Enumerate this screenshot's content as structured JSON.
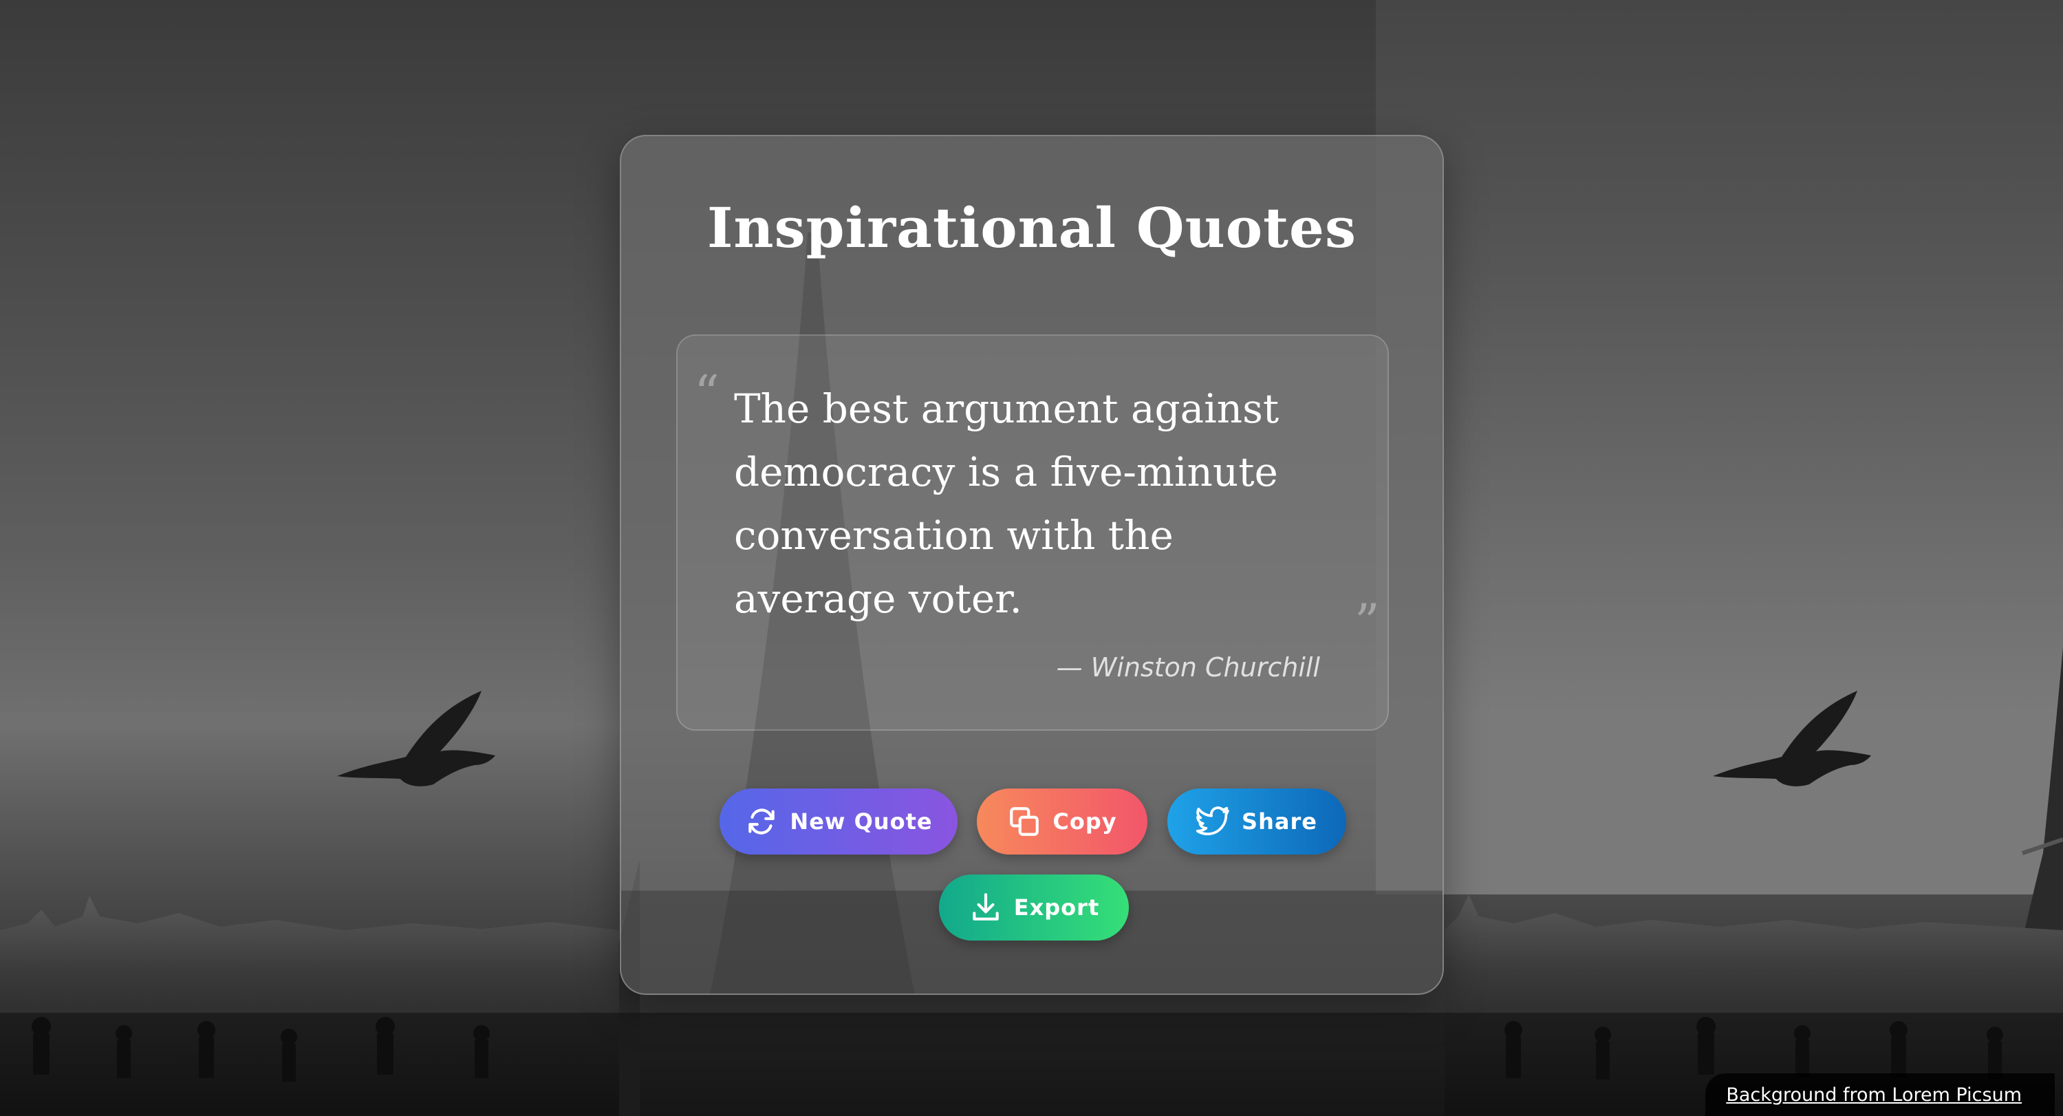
{
  "app": {
    "title": "Inspirational Quotes"
  },
  "quote": {
    "open_mark": "“",
    "close_mark": "”",
    "text": "The best argument against democracy is a five-minute conversation with the average voter.",
    "author": "— Winston Churchill"
  },
  "actions": {
    "new_quote_label": "New Quote",
    "copy_label": "Copy",
    "share_label": "Share",
    "export_label": "Export",
    "icons": {
      "new_quote": "refresh-icon",
      "copy": "copy-icon",
      "share": "twitter-icon",
      "export": "download-icon"
    }
  },
  "credit": {
    "text": "Background from Lorem Picsum"
  },
  "colors": {
    "new_quote_gradient": [
      "#5567e8",
      "#8a55e0"
    ],
    "copy_gradient": [
      "#f7895c",
      "#f2566a"
    ],
    "share_gradient": [
      "#1fa2e8",
      "#0d68b8"
    ],
    "export_gradient": [
      "#12a98c",
      "#36df77"
    ]
  }
}
